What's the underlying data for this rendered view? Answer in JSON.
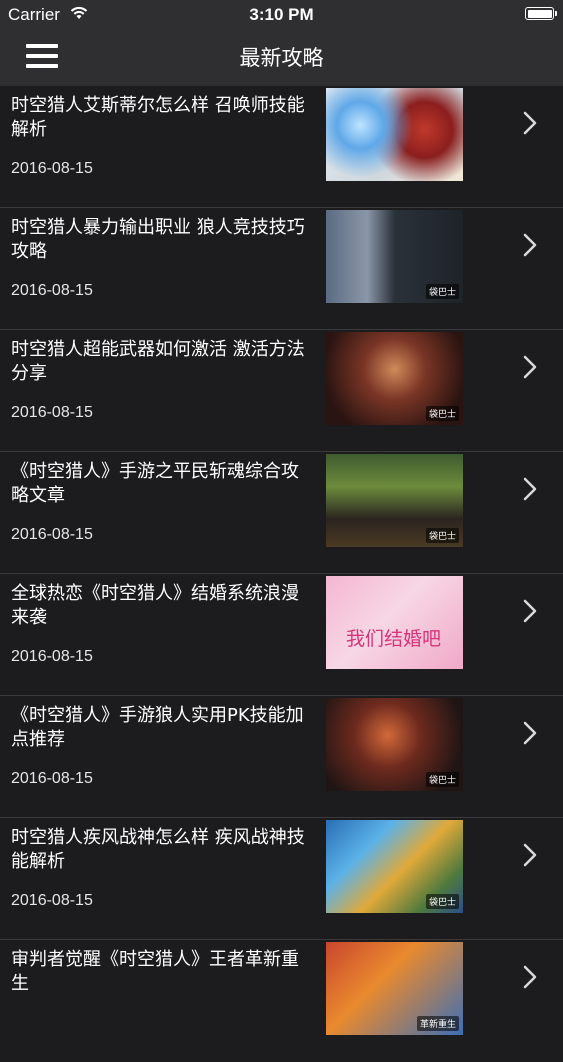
{
  "status_bar": {
    "carrier": "Carrier",
    "time": "3:10 PM"
  },
  "nav": {
    "title": "最新攻略",
    "menu_icon": "hamburger-menu-icon"
  },
  "articles": [
    {
      "title": "时空猎人艾斯蒂尔怎么样 召唤师技能解析",
      "date": "2016-08-15",
      "thumb_caption": ""
    },
    {
      "title": "时空猎人暴力输出职业 狼人竞技技巧攻略",
      "date": "2016-08-15",
      "thumb_caption": "袋巴士"
    },
    {
      "title": "时空猎人超能武器如何激活 激活方法分享",
      "date": "2016-08-15",
      "thumb_caption": "袋巴士"
    },
    {
      "title": "《时空猎人》手游之平民斩魂综合攻略文章",
      "date": "2016-08-15",
      "thumb_caption": "袋巴士"
    },
    {
      "title": "全球热恋《时空猎人》结婚系统浪漫来袭",
      "date": "2016-08-15",
      "thumb_caption": "我们结婚吧"
    },
    {
      "title": "《时空猎人》手游狼人实用PK技能加点推荐",
      "date": "2016-08-15",
      "thumb_caption": "袋巴士"
    },
    {
      "title": "时空猎人疾风战神怎么样 疾风战神技能解析",
      "date": "2016-08-15",
      "thumb_caption": "袋巴士"
    },
    {
      "title": "审判者觉醒《时空猎人》王者革新重生",
      "date": "",
      "thumb_caption": "革新重生"
    }
  ]
}
